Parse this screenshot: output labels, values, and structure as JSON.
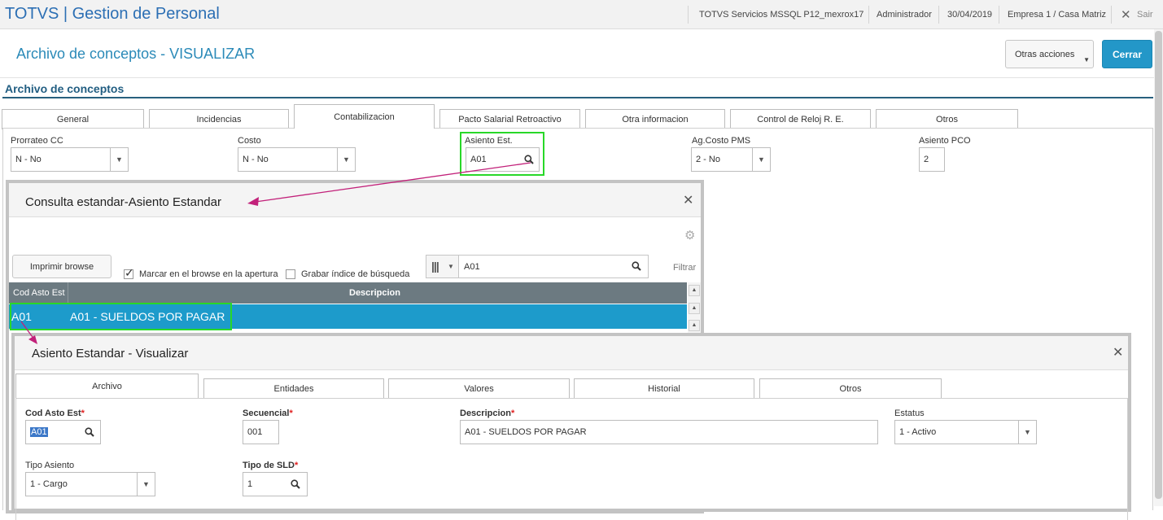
{
  "topbar": {
    "app_title": "TOTVS | Gestion de Personal",
    "environment": "TOTVS Servicios MSSQL P12_mexrox17",
    "user": "Administrador",
    "date": "30/04/2019",
    "company": "Empresa 1 / Casa Matriz",
    "exit_label": "Sair"
  },
  "header": {
    "page_title": "Archivo de conceptos - VISUALIZAR",
    "otras_label": "Otras acciones",
    "cerrar_label": "Cerrar"
  },
  "section_title": "Archivo de conceptos",
  "tabs": [
    {
      "label": "General"
    },
    {
      "label": "Incidencias"
    },
    {
      "label": "Contabilizacion"
    },
    {
      "label": "Pacto Salarial Retroactivo"
    },
    {
      "label": "Otra informacion"
    },
    {
      "label": "Control de Reloj R. E."
    },
    {
      "label": "Otros"
    }
  ],
  "fields": {
    "prorrateo": {
      "label": "Prorrateo CC",
      "value": "N - No"
    },
    "costo": {
      "label": "Costo",
      "value": "N - No"
    },
    "asiento_est": {
      "label": "Asiento Est.",
      "value": "A01"
    },
    "ag_costo": {
      "label": "Ag.Costo PMS",
      "value": "2 - No"
    },
    "asiento_pco": {
      "label": "Asiento PCO",
      "value": "2"
    }
  },
  "consulta": {
    "title": "Consulta estandar-Asiento Estandar",
    "imprimir_label": "Imprimir browse",
    "marcar_label": "Marcar en el browse en la apertura",
    "grabar_label": "Grabar índice de búsqueda",
    "search_value": "A01",
    "filtrar_label": "Filtrar",
    "columns": [
      "Cod Asto Est",
      "Descripcion"
    ],
    "rows": [
      {
        "code": "A01",
        "desc": "A01 - SUELDOS POR PAGAR"
      }
    ]
  },
  "asiento": {
    "title": "Asiento Estandar - Visualizar",
    "tabs": [
      {
        "label": "Archivo"
      },
      {
        "label": "Entidades"
      },
      {
        "label": "Valores"
      },
      {
        "label": "Historial"
      },
      {
        "label": "Otros"
      }
    ],
    "cod": {
      "label": "Cod Asto Est",
      "value": "A01"
    },
    "secuencial": {
      "label": "Secuencial",
      "value": "001"
    },
    "descripcion": {
      "label": "Descripcion",
      "value": "A01 - SUELDOS POR PAGAR"
    },
    "estatus": {
      "label": "Estatus",
      "value": "1 - Activo"
    },
    "tipo_asiento": {
      "label": "Tipo Asiento",
      "value": "1 - Cargo"
    },
    "tipo_sld": {
      "label": "Tipo de SLD",
      "value": "1"
    },
    "required_mark": "*"
  },
  "colors": {
    "brand": "#2c6fb4",
    "accent": "#2397c8",
    "highlight": "#28d828",
    "arrow": "#c2217a"
  }
}
